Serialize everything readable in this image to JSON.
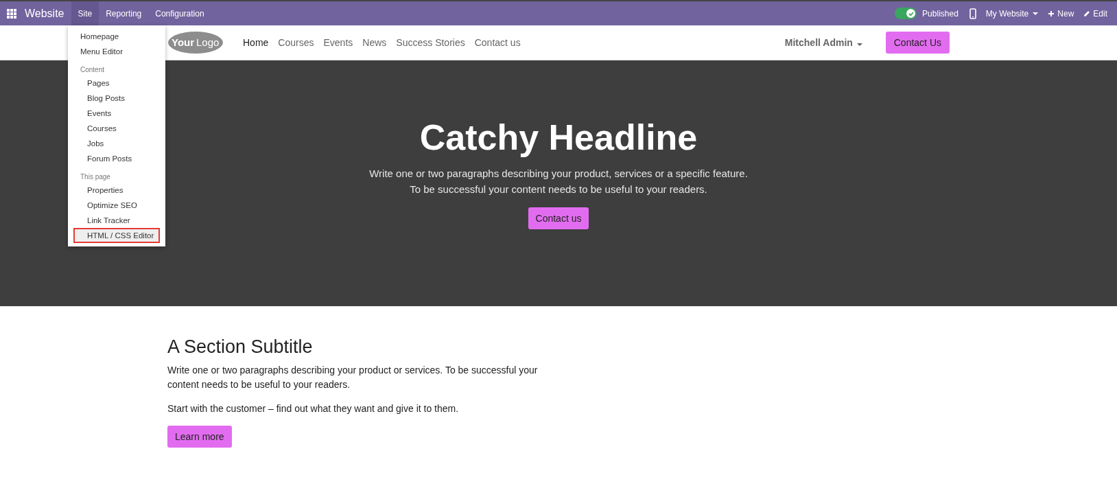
{
  "top_bar": {
    "app_name": "Website",
    "menus": [
      {
        "label": "Site",
        "selected": true
      },
      {
        "label": "Reporting",
        "selected": false
      },
      {
        "label": "Configuration",
        "selected": false
      }
    ],
    "published": {
      "label": "Published",
      "on": true
    },
    "website_switcher": "My Website",
    "new_label": "New",
    "edit_label": "Edit"
  },
  "site_menu": {
    "groups": [
      {
        "items": [
          {
            "label": "Homepage",
            "selected": false
          },
          {
            "label": "Menu Editor",
            "selected": false
          }
        ]
      },
      {
        "heading": "Content",
        "items": [
          {
            "label": "Pages",
            "selected": false
          },
          {
            "label": "Blog Posts",
            "selected": false
          },
          {
            "label": "Events",
            "selected": false
          },
          {
            "label": "Courses",
            "selected": false
          },
          {
            "label": "Jobs",
            "selected": false
          },
          {
            "label": "Forum Posts",
            "selected": false
          }
        ]
      },
      {
        "heading": "This page",
        "items": [
          {
            "label": "Properties",
            "selected": false
          },
          {
            "label": "Optimize SEO",
            "selected": false
          },
          {
            "label": "Link Tracker",
            "selected": false
          },
          {
            "label": "HTML / CSS Editor",
            "selected": true
          }
        ]
      }
    ]
  },
  "header": {
    "logo": {
      "first": "Your",
      "second": "Logo"
    },
    "nav": [
      {
        "label": "Home",
        "selected": true
      },
      {
        "label": "Courses",
        "selected": false
      },
      {
        "label": "Events",
        "selected": false
      },
      {
        "label": "News",
        "selected": false
      },
      {
        "label": "Success Stories",
        "selected": false
      },
      {
        "label": "Contact us",
        "selected": false
      }
    ],
    "user": "Mitchell Admin",
    "cta": "Contact Us"
  },
  "hero": {
    "headline": "Catchy Headline",
    "lines": [
      "Write one or two paragraphs describing your product, services or a specific feature.",
      "To be successful your content needs to be useful to your readers."
    ],
    "button": "Contact us"
  },
  "section": {
    "subtitle": "A Section Subtitle",
    "paragraphs": [
      "Write one or two paragraphs describing your product or services. To be successful your content needs to be useful to your readers.",
      "Start with the customer – find out what they want and give it to them."
    ],
    "button": "Learn more"
  }
}
